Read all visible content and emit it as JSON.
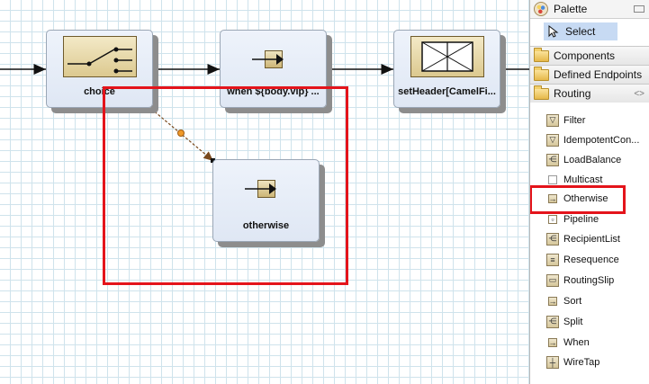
{
  "diagram": {
    "nodes": {
      "choice": "choice",
      "when": "when ${body.vip} ...",
      "set_header": "setHeader[CamelFi...",
      "otherwise": "otherwise"
    }
  },
  "palette": {
    "title": "Palette",
    "select_label": "Select",
    "drawers": [
      "Components",
      "Defined Endpoints",
      "Routing"
    ],
    "routing_items": [
      {
        "label": "Filter",
        "icon": "filter-icon"
      },
      {
        "label": "IdempotentCon...",
        "icon": "idempotent-consumer-icon"
      },
      {
        "label": "LoadBalance",
        "icon": "load-balance-icon"
      },
      {
        "label": "Multicast",
        "icon": "multicast-icon"
      },
      {
        "label": "Otherwise",
        "icon": "otherwise-icon"
      },
      {
        "label": "Pipeline",
        "icon": "pipeline-icon"
      },
      {
        "label": "RecipientList",
        "icon": "recipient-list-icon"
      },
      {
        "label": "Resequence",
        "icon": "resequence-icon"
      },
      {
        "label": "RoutingSlip",
        "icon": "routing-slip-icon"
      },
      {
        "label": "Sort",
        "icon": "sort-icon"
      },
      {
        "label": "Split",
        "icon": "split-icon"
      },
      {
        "label": "When",
        "icon": "when-icon"
      },
      {
        "label": "WireTap",
        "icon": "wiretap-icon"
      }
    ]
  },
  "colors": {
    "highlight": "#e4141b",
    "selection": "#c7daf3",
    "grid": "#cfe3ec"
  }
}
